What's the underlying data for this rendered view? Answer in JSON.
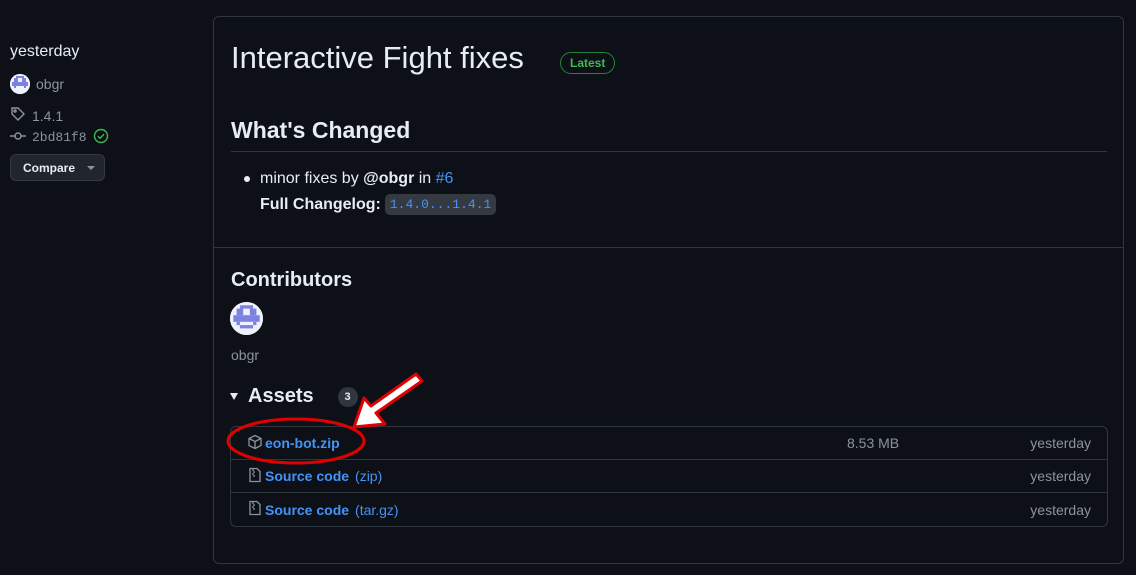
{
  "sidebar": {
    "date": "yesterday",
    "author": "obgr",
    "tag": "1.4.1",
    "commit": "2bd81f8",
    "compare_label": "Compare"
  },
  "release": {
    "title": "Interactive Fight fixes",
    "latest_badge": "Latest",
    "whats_changed": "What's Changed",
    "change_item": {
      "text_before": "minor fixes by ",
      "user": "@obgr",
      "text_mid": " in ",
      "pr": "#6"
    },
    "full_changelog_label": "Full Changelog",
    "full_changelog_colon": ":",
    "changelog_range": "1.4.0...1.4.1"
  },
  "contributors": {
    "title": "Contributors",
    "names": [
      "obgr"
    ]
  },
  "assets": {
    "title": "Assets",
    "count": "3",
    "items": [
      {
        "name": "eon-bot.zip",
        "suffix": "",
        "size": "8.53 MB",
        "date": "yesterday",
        "icon": "package-icon"
      },
      {
        "name": "Source code",
        "suffix": "(zip)",
        "size": "",
        "date": "yesterday",
        "icon": "file-zip-icon"
      },
      {
        "name": "Source code",
        "suffix": "(tar.gz)",
        "size": "",
        "date": "yesterday",
        "icon": "file-zip-icon"
      }
    ]
  },
  "colors": {
    "background": "#0d1117",
    "link": "#4493f8",
    "latest_green": "#3fb950",
    "annotation_red": "#e00000"
  }
}
